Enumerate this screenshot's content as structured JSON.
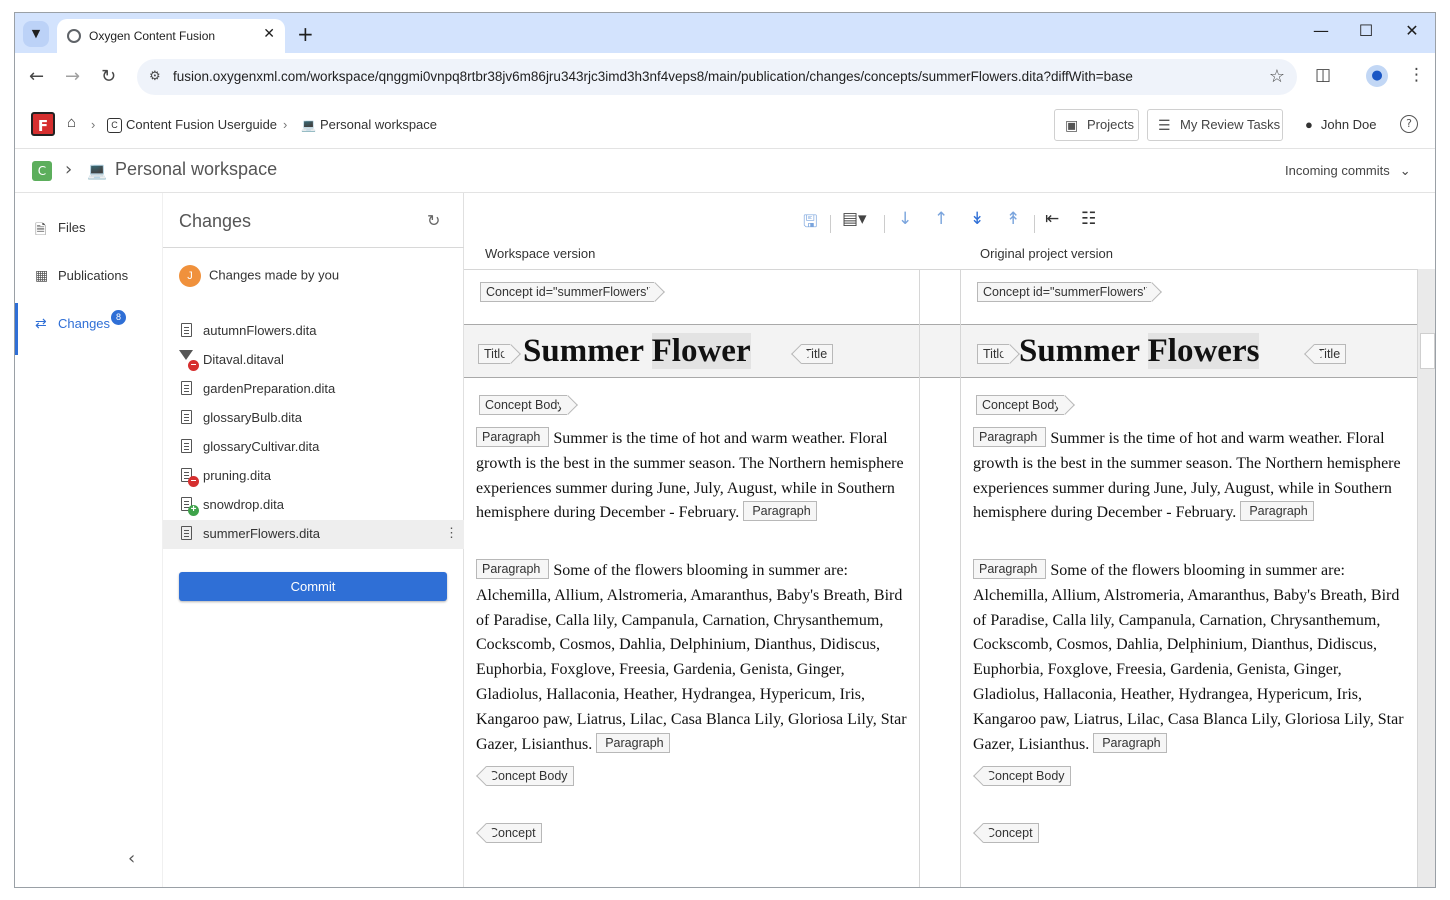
{
  "browser": {
    "tab_title": "Oxygen Content Fusion",
    "url": "fusion.oxygenxml.com/workspace/qnggmi0vnpq8rtbr38jv6m86jru343rjc3imd3h3nf4veps8/main/publication/changes/concepts/summerFlowers.dita?diffWith=base"
  },
  "header": {
    "logo_letter": "F",
    "breadcrumb_project": "Content Fusion Userguide",
    "breadcrumb_project_badge": "C",
    "breadcrumb_workspace": "Personal workspace",
    "projects_label": "Projects",
    "review_tasks_label": "My Review Tasks",
    "user_name": "John Doe"
  },
  "projectbar": {
    "badge": "C",
    "title": "Personal workspace",
    "incoming": "Incoming commits"
  },
  "leftnav": {
    "items": [
      {
        "label": "Files"
      },
      {
        "label": "Publications"
      },
      {
        "label": "Changes",
        "badge": "8"
      }
    ]
  },
  "changes": {
    "title": "Changes",
    "author_initial": "J",
    "author_label": "Changes made by you",
    "files": [
      {
        "name": "autumnFlowers.dita",
        "status": "modified"
      },
      {
        "name": "Ditaval.ditaval",
        "status": "deleted"
      },
      {
        "name": "gardenPreparation.dita",
        "status": "modified"
      },
      {
        "name": "glossaryBulb.dita",
        "status": "modified"
      },
      {
        "name": "glossaryCultivar.dita",
        "status": "modified"
      },
      {
        "name": "pruning.dita",
        "status": "deleted"
      },
      {
        "name": "snowdrop.dita",
        "status": "added"
      },
      {
        "name": "summerFlowers.dita",
        "status": "modified",
        "selected": true
      }
    ],
    "commit_label": "Commit"
  },
  "diff": {
    "left_header": "Workspace version",
    "right_header": "Original project version",
    "concept_tag": "Concept id=\"summerFlowers\"",
    "title_tag": "Title",
    "left_title_a": "Summer ",
    "left_title_b": "Flower",
    "right_title_a": "Summer ",
    "right_title_b": "Flowers",
    "body_tag": "Concept Body",
    "para_tag": "Paragraph",
    "para1": "Summer is the time of hot and warm weather. Floral growth is the best in the summer season. The Northern hemisphere experiences summer during June, July, August, while in Southern hemisphere during December - February.",
    "para2": "Some of the flowers blooming in summer are: Alchemilla, Allium, Alstromeria, Amaranthus, Baby's Breath, Bird of Paradise, Calla lily, Campanula, Carnation, Chrysanthemum, Cockscomb, Cosmos, Dahlia, Delphinium, Dianthus, Didiscus, Euphorbia, Foxglove, Freesia, Gardenia, Genista, Ginger, Gladiolus, Hallaconia, Heather, Hydrangea, Hypericum, Iris, Kangaroo paw, Liatrus, Lilac, Casa Blanca Lily, Gloriosa Lily, Star Gazer, Lisianthus.",
    "body_end_tag": "Concept Body",
    "concept_end_tag": "Concept"
  }
}
